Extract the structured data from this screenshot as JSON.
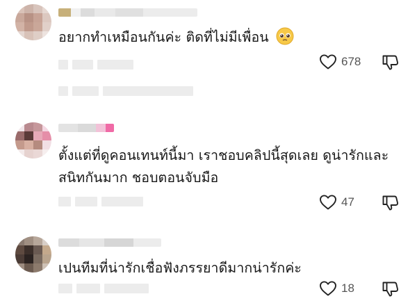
{
  "comments": [
    {
      "text": "อยากทำเหมือนกันค่ะ ติดที่ไม่มีเพื่อน",
      "emoji_icon": "pleading-face-emoji",
      "likes": "678"
    },
    {
      "text": "ตั้งแต่ที่ดูคอนเทนท์นี้มา เราชอบคลิปนี้สุดเลย ดูน่ารักและสนิทกันมาก ชอบตอนจับมือ",
      "likes": "47"
    },
    {
      "text": "เปนทีมที่น่ารักเชื่อฟังภรรยาดีมากน่ารักค่ะ",
      "likes": "18"
    }
  ],
  "icons": {
    "like": "heart-icon",
    "dislike": "thumbs-down-icon"
  },
  "colors": {
    "icon_stroke": "#222222",
    "count_text": "#555555",
    "blur_gray": "#ececec"
  }
}
